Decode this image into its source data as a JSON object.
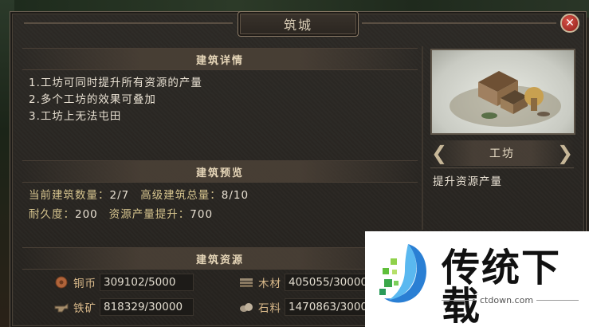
{
  "title": "筑城",
  "close_symbol": "✕",
  "details": {
    "header": "建筑详情",
    "lines": [
      "1.工坊可同时提升所有资源的产量",
      "2.多个工坊的效果可叠加",
      "3.工坊上无法屯田"
    ]
  },
  "preview": {
    "header": "建筑预览",
    "current_count_label": "当前建筑数量：",
    "current_count_value": "2/7",
    "advanced_total_label": "高级建筑总量：",
    "advanced_total_value": "8/10",
    "durability_label": "耐久度：",
    "durability_value": "200",
    "resource_boost_label": "资源产量提升：",
    "resource_boost_value": "700"
  },
  "resources": {
    "header": "建筑资源",
    "items": [
      {
        "name": "铜币",
        "value": "309102/5000",
        "icon": "copper-coin-icon"
      },
      {
        "name": "木材",
        "value": "405055/30000",
        "icon": "wood-icon"
      },
      {
        "name": "铁矿",
        "value": "818329/30000",
        "icon": "iron-ore-icon"
      },
      {
        "name": "石料",
        "value": "1470863/30000",
        "icon": "stone-icon"
      }
    ]
  },
  "building": {
    "name": "工坊",
    "description": "提升资源产量",
    "prev_arrow": "❮",
    "next_arrow": "❯"
  },
  "watermark": {
    "text": "传统下载",
    "url": "ctdown.com"
  }
}
